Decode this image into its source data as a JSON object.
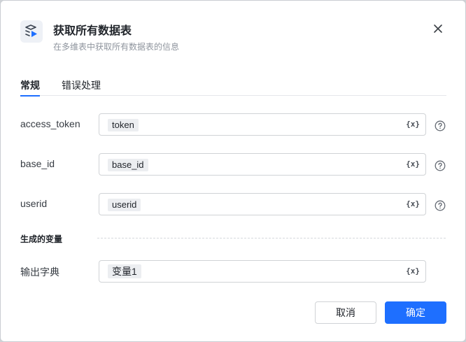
{
  "dialog": {
    "title": "获取所有数据表",
    "subtitle": "在多维表中获取所有数据表的信息",
    "header_icon": "table-stack-icon",
    "close_icon": "close-icon"
  },
  "tabs": [
    {
      "label": "常规",
      "active": true
    },
    {
      "label": "错误处理",
      "active": false
    }
  ],
  "fields": [
    {
      "label": "access_token",
      "value": "token",
      "var_icon": "{x}"
    },
    {
      "label": "base_id",
      "value": "base_id",
      "var_icon": "{x}"
    },
    {
      "label": "userid",
      "value": "userid",
      "var_icon": "{x}"
    }
  ],
  "output": {
    "section_title": "生成的变量",
    "label": "输出字典",
    "value": "变量1",
    "var_icon": "{x}"
  },
  "footer": {
    "cancel_label": "取消",
    "ok_label": "确定"
  },
  "colors": {
    "accent": "#1e6fff",
    "text": "#1f2329",
    "muted": "#8f959e"
  }
}
